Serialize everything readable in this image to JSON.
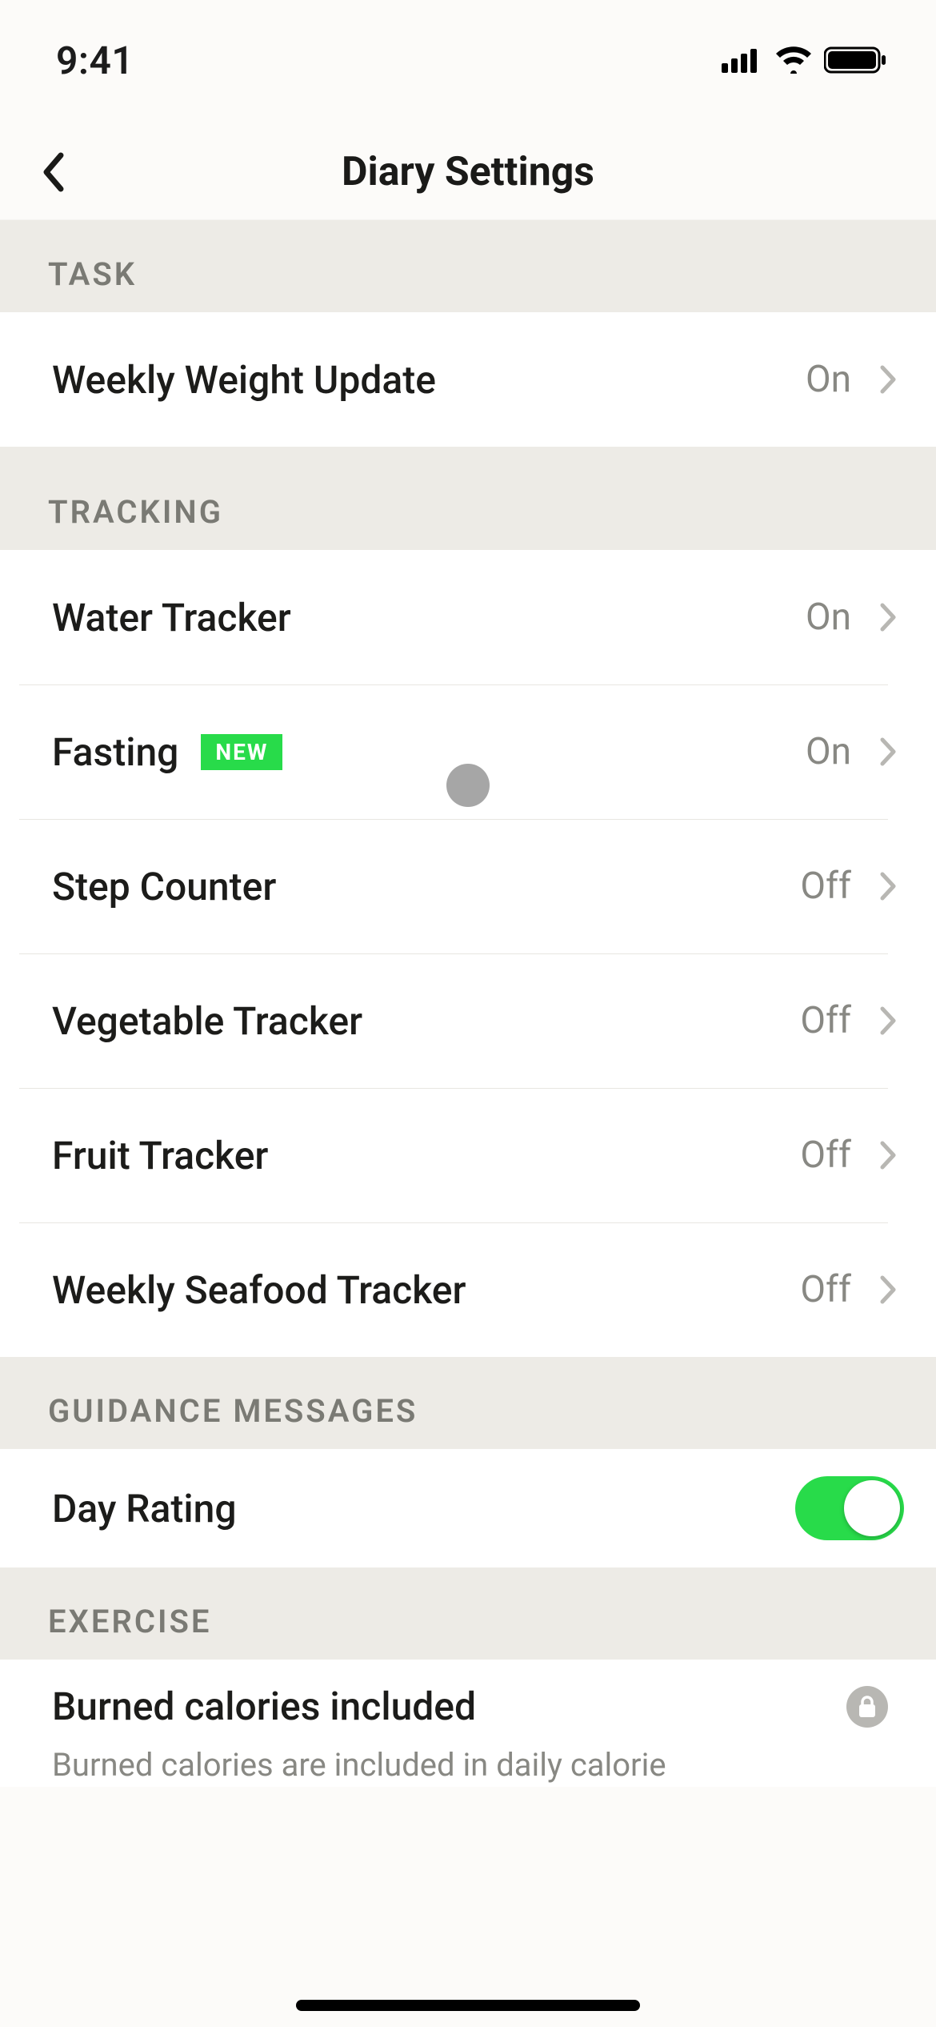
{
  "status": {
    "time": "9:41"
  },
  "nav": {
    "title": "Diary Settings"
  },
  "sections": {
    "task": {
      "header": "TASK",
      "items": [
        {
          "label": "Weekly Weight Update",
          "value": "On"
        }
      ]
    },
    "tracking": {
      "header": "TRACKING",
      "items": [
        {
          "label": "Water Tracker",
          "value": "On"
        },
        {
          "label": "Fasting",
          "badge": "NEW",
          "value": "On"
        },
        {
          "label": "Step Counter",
          "value": "Off"
        },
        {
          "label": "Vegetable Tracker",
          "value": "Off"
        },
        {
          "label": "Fruit Tracker",
          "value": "Off"
        },
        {
          "label": "Weekly Seafood Tracker",
          "value": "Off"
        }
      ]
    },
    "guidance": {
      "header": "GUIDANCE MESSAGES",
      "items": [
        {
          "label": "Day Rating",
          "toggle": true
        }
      ]
    },
    "exercise": {
      "header": "EXERCISE",
      "title": "Burned calories included",
      "desc": "Burned calories are included in daily calorie"
    }
  }
}
